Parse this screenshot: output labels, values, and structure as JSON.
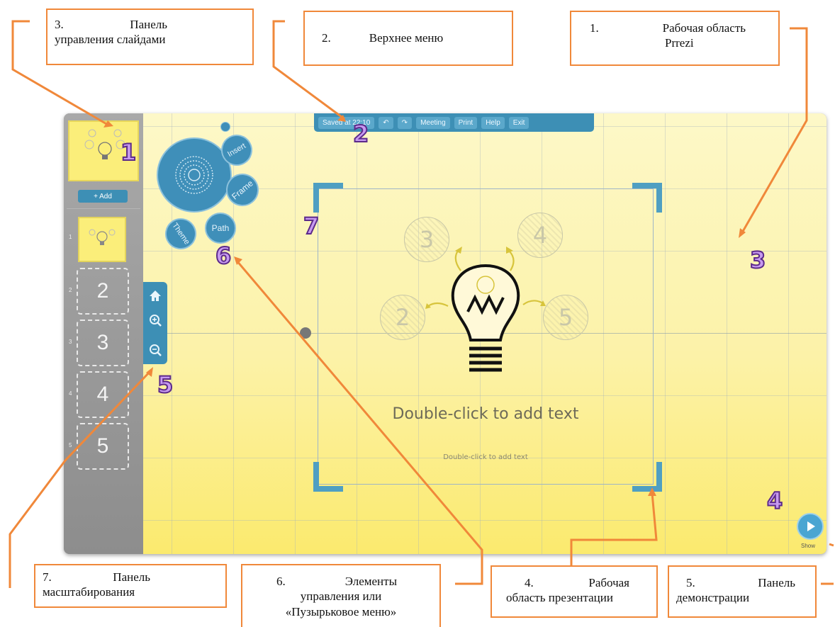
{
  "callouts": {
    "c3": {
      "num": "3.",
      "line1": "Панель",
      "line2": "управления слайдами"
    },
    "c2": {
      "num": "2.",
      "text": "Верхнее меню"
    },
    "c1": {
      "num": "1.",
      "line1": "Рабочая область",
      "line2": "Prrezi"
    },
    "c7": {
      "num": "7.",
      "line1": "Панель",
      "line2": "масштабирования"
    },
    "c6": {
      "num": "6.",
      "line1": "Элементы",
      "line2": "управления или",
      "line3": "«Пузырьковое меню»"
    },
    "c4": {
      "num": "4.",
      "line1": "Рабочая",
      "line2": "область презентации"
    },
    "c5": {
      "num": "5.",
      "line1": "Панель",
      "line2": "демонстрации"
    }
  },
  "badges": {
    "b1": "1",
    "b2": "2",
    "b3": "3",
    "b4": "4",
    "b5": "5",
    "b6": "6",
    "b7": "7"
  },
  "sidebar": {
    "add_label": "+ Add",
    "slides": [
      {
        "index": "1",
        "label": ""
      },
      {
        "index": "2",
        "label": "2"
      },
      {
        "index": "3",
        "label": "3"
      },
      {
        "index": "4",
        "label": "4"
      },
      {
        "index": "5",
        "label": "5"
      }
    ]
  },
  "topmenu": {
    "saved": "Saved at 22:10",
    "undo": "↶",
    "redo": "↷",
    "meeting": "Meeting",
    "print": "Print",
    "help": "Help",
    "exit": "Exit"
  },
  "bubbles": {
    "insert": "Insert",
    "frame": "Frame",
    "path": "Path",
    "theme": "Theme"
  },
  "canvas": {
    "circles": [
      "3",
      "4",
      "2",
      "5"
    ],
    "title_placeholder": "Double-click to add text",
    "subtitle_placeholder": "Double-click to add text"
  },
  "show": {
    "label": "Show"
  },
  "colors": {
    "accent": "#3d8fb5",
    "callout_border": "#f0883a",
    "badge": "#c79af0"
  }
}
